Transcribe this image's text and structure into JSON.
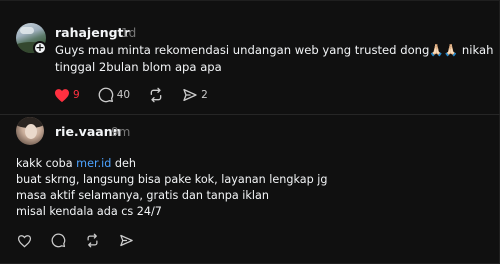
{
  "post1": {
    "username": "rahajengtr",
    "time": "1d",
    "follow_icon": "plus",
    "lines": [
      "Guys mau minta rekomendasi undangan web yang trusted dong🙏🏻🙏🏻 nikah",
      "tinggal 2bulan blom apa apa"
    ],
    "actions": {
      "like_count": "9",
      "reply_count": "40",
      "share_count": "2"
    },
    "liked_color": "#ff3040"
  },
  "post2": {
    "username": "rie.vaann",
    "time": "9m",
    "line1_prefix": "kakk coba ",
    "line1_link": "mer.id",
    "line1_suffix": " deh",
    "lines": [
      "buat skrng, langsung bisa pake kok, layanan lengkap jg",
      "masa aktif selamanya, gratis dan tanpa iklan",
      "misal kendala ada cs 24/7"
    ],
    "link_color": "#4da3ff"
  }
}
